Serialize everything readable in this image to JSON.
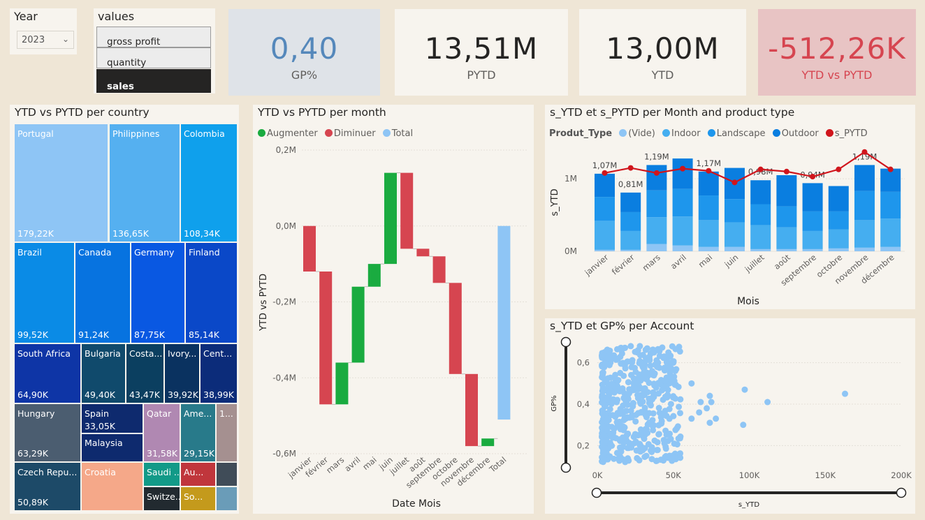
{
  "year_slicer": {
    "title": "Year",
    "selected": "2023"
  },
  "values_slicer": {
    "title": "values",
    "options": [
      "gross profit",
      "quantity",
      "sales"
    ],
    "selected": "sales"
  },
  "cards": [
    {
      "value": "0,40",
      "label": "GP%",
      "bg": "#dfe3e8",
      "color": "#5588bb"
    },
    {
      "value": "13,51M",
      "label": "PYTD",
      "bg": "#f7f4ee",
      "color": "#252423"
    },
    {
      "value": "13,00M",
      "label": "YTD",
      "bg": "#f7f4ee",
      "color": "#252423"
    },
    {
      "value": "-512,26K",
      "label": "YTD vs PYTD",
      "bg": "#e8c4c4",
      "color": "#d64550"
    }
  ],
  "treemap": {
    "title": "YTD vs PYTD per country",
    "cells": [
      {
        "name": "Portugal",
        "value": "179,22K",
        "color": "#8ec5f5"
      },
      {
        "name": "Philippines",
        "value": "136,65K",
        "color": "#55b0f0"
      },
      {
        "name": "Colombia",
        "value": "108,34K",
        "color": "#0fa0ec"
      },
      {
        "name": "Brazil",
        "value": "99,52K",
        "color": "#0a8be6"
      },
      {
        "name": "Canada",
        "value": "91,24K",
        "color": "#0773e0"
      },
      {
        "name": "Germany",
        "value": "87,75K",
        "color": "#0958e2"
      },
      {
        "name": "Finland",
        "value": "85,14K",
        "color": "#0a48c8"
      },
      {
        "name": "South Africa",
        "value": "64,90K",
        "color": "#0e35a6"
      },
      {
        "name": "Bulgaria",
        "value": "49,40K",
        "color": "#104a6c"
      },
      {
        "name": "Costa...",
        "value": "43,47K",
        "color": "#0b3f60"
      },
      {
        "name": "Ivory...",
        "value": "39,92K",
        "color": "#0a3260"
      },
      {
        "name": "Cent...",
        "value": "38,99K",
        "color": "#0c2c7a"
      },
      {
        "name": "Hungary",
        "value": "63,29K",
        "color": "#4b5d70"
      },
      {
        "name": "Spain",
        "value": "33,05K",
        "color": "#0e2a6e"
      },
      {
        "name": "Malaysia",
        "value": "",
        "color": "#0e2a6e"
      },
      {
        "name": "Qatar",
        "value": "31,58K",
        "color": "#b088b2"
      },
      {
        "name": "Ame...",
        "value": "29,15K",
        "color": "#287a8a"
      },
      {
        "name": "1...",
        "value": "",
        "color": "#a59090"
      },
      {
        "name": "Czech Repu...",
        "value": "50,89K",
        "color": "#1d4a68"
      },
      {
        "name": "Croatia",
        "value": "",
        "color": "#f5a889"
      },
      {
        "name": "Saudi ...",
        "value": "",
        "color": "#129a88"
      },
      {
        "name": "Au...",
        "value": "",
        "color": "#c0363c"
      },
      {
        "name": "",
        "value": "",
        "color": "#404c58"
      },
      {
        "name": "Switze...",
        "value": "",
        "color": "#222a30"
      },
      {
        "name": "So...",
        "value": "",
        "color": "#c49a1c"
      },
      {
        "name": "",
        "value": "",
        "color": "#6a9cb8"
      }
    ]
  },
  "waterfall": {
    "title": "YTD vs PYTD per month",
    "legend": [
      {
        "label": "Augmenter",
        "color": "#1aab40"
      },
      {
        "label": "Diminuer",
        "color": "#d64550"
      },
      {
        "label": "Total",
        "color": "#8ec5f5"
      }
    ]
  },
  "combo": {
    "title": "s_YTD et s_PYTD per Month and product type",
    "legend_title": "Produt_Type",
    "legend": [
      {
        "label": "(Vide)",
        "color": "#8ec5f5"
      },
      {
        "label": "Indoor",
        "color": "#45aef0"
      },
      {
        "label": "Landscape",
        "color": "#1e96ec"
      },
      {
        "label": "Outdoor",
        "color": "#0a7ee0"
      },
      {
        "label": "s_PYTD",
        "color": "#d0151c"
      }
    ]
  },
  "scatter": {
    "title": "s_YTD et GP% per Account"
  },
  "chart_data": [
    {
      "type": "bar",
      "subtype": "waterfall",
      "categories": [
        "janvier",
        "février",
        "mars",
        "avril",
        "mai",
        "juin",
        "juillet",
        "août",
        "septembre",
        "octobre",
        "novembre",
        "décembre",
        "Total"
      ],
      "changes": [
        -0.12,
        -0.35,
        0.11,
        0.2,
        0.06,
        0.24,
        -0.2,
        -0.02,
        -0.07,
        -0.24,
        -0.19,
        0.02,
        null
      ],
      "total": -0.51,
      "xlabel": "Date Mois",
      "ylabel": "YTD vs PYTD",
      "y_ticks": [
        "0,2M",
        "0,0M",
        "-0,2M",
        "-0,4M",
        "-0,6M"
      ],
      "ylim": [
        -0.6,
        0.2
      ]
    },
    {
      "type": "bar",
      "subtype": "stacked_bar_with_line",
      "categories": [
        "janvier",
        "février",
        "mars",
        "avril",
        "mai",
        "juin",
        "juillet",
        "août",
        "septembre",
        "octobre",
        "novembre",
        "décembre"
      ],
      "series": [
        {
          "name": "(Vide)",
          "values": [
            0.02,
            0.02,
            0.1,
            0.08,
            0.06,
            0.06,
            0.03,
            0.03,
            0.03,
            0.04,
            0.05,
            0.06
          ]
        },
        {
          "name": "Indoor",
          "values": [
            0.4,
            0.26,
            0.37,
            0.4,
            0.37,
            0.34,
            0.33,
            0.3,
            0.25,
            0.26,
            0.38,
            0.39
          ]
        },
        {
          "name": "Landscape",
          "values": [
            0.33,
            0.26,
            0.37,
            0.38,
            0.34,
            0.32,
            0.29,
            0.29,
            0.27,
            0.25,
            0.4,
            0.37
          ]
        },
        {
          "name": "Outdoor",
          "values": [
            0.32,
            0.27,
            0.35,
            0.42,
            0.33,
            0.43,
            0.33,
            0.43,
            0.39,
            0.35,
            0.36,
            0.32
          ]
        },
        {
          "name": "s_PYTD",
          "values": [
            1.08,
            1.15,
            1.08,
            1.14,
            1.11,
            0.95,
            1.13,
            1.1,
            1.03,
            1.13,
            1.37,
            1.13
          ]
        }
      ],
      "data_labels": [
        "1,07M",
        "0,81M",
        "1,19M",
        "",
        "1,17M",
        "",
        "0,98M",
        "",
        "0,94M",
        "",
        "1,19M",
        ""
      ],
      "xlabel": "Mois",
      "ylabel": "s_YTD",
      "y_ticks": [
        "0M",
        "1M"
      ],
      "ylim": [
        0,
        1.3
      ]
    },
    {
      "type": "scatter",
      "xlabel": "s_YTD",
      "ylabel": "GP%",
      "x_ticks": [
        "0K",
        "50K",
        "100K",
        "150K",
        "200K"
      ],
      "y_ticks": [
        "0,2",
        "0,4",
        "0,6"
      ],
      "xlim": [
        0,
        200000
      ],
      "ylim": [
        0.1,
        0.7
      ],
      "points": [
        [
          97000,
          0.47
        ],
        [
          112000,
          0.41
        ],
        [
          163000,
          0.45
        ],
        [
          96000,
          0.3
        ],
        [
          78000,
          0.33
        ],
        [
          72000,
          0.38
        ],
        [
          74000,
          0.31
        ],
        [
          74000,
          0.44
        ],
        [
          68000,
          0.41
        ],
        [
          75000,
          0.41
        ],
        [
          67000,
          0.36
        ],
        [
          62000,
          0.33
        ],
        [
          62000,
          0.5
        ],
        [
          50000,
          0.6
        ],
        [
          44000,
          0.63
        ],
        [
          37000,
          0.66
        ],
        [
          28000,
          0.68
        ],
        [
          22000,
          0.68
        ]
      ],
      "cluster": {
        "x_range": [
          3000,
          55000
        ],
        "y_range": [
          0.12,
          0.68
        ],
        "density": "high"
      }
    }
  ]
}
